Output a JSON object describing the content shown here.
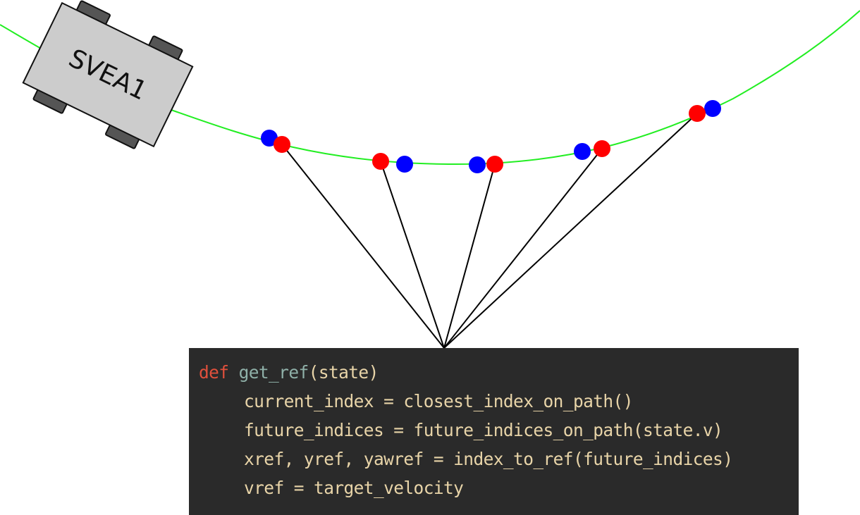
{
  "vehicle": {
    "label": "SVEA1"
  },
  "colors": {
    "path": "#22ee22",
    "reference_point": "#ff0000",
    "path_point": "#0000ff",
    "code_background": "#2a2a2a",
    "keyword": "#e0503c",
    "function_name": "#8fb0a8",
    "code_text": "#e8d4a8"
  },
  "code": {
    "def_keyword": "def",
    "function_name": "get_ref",
    "signature_rest": "(state)",
    "lines": [
      "current_index = closest_index_on_path()",
      "future_indices = future_indices_on_path(state.v)",
      "xref, yref, yawref = index_to_ref(future_indices)",
      "vref = target_velocity"
    ]
  }
}
